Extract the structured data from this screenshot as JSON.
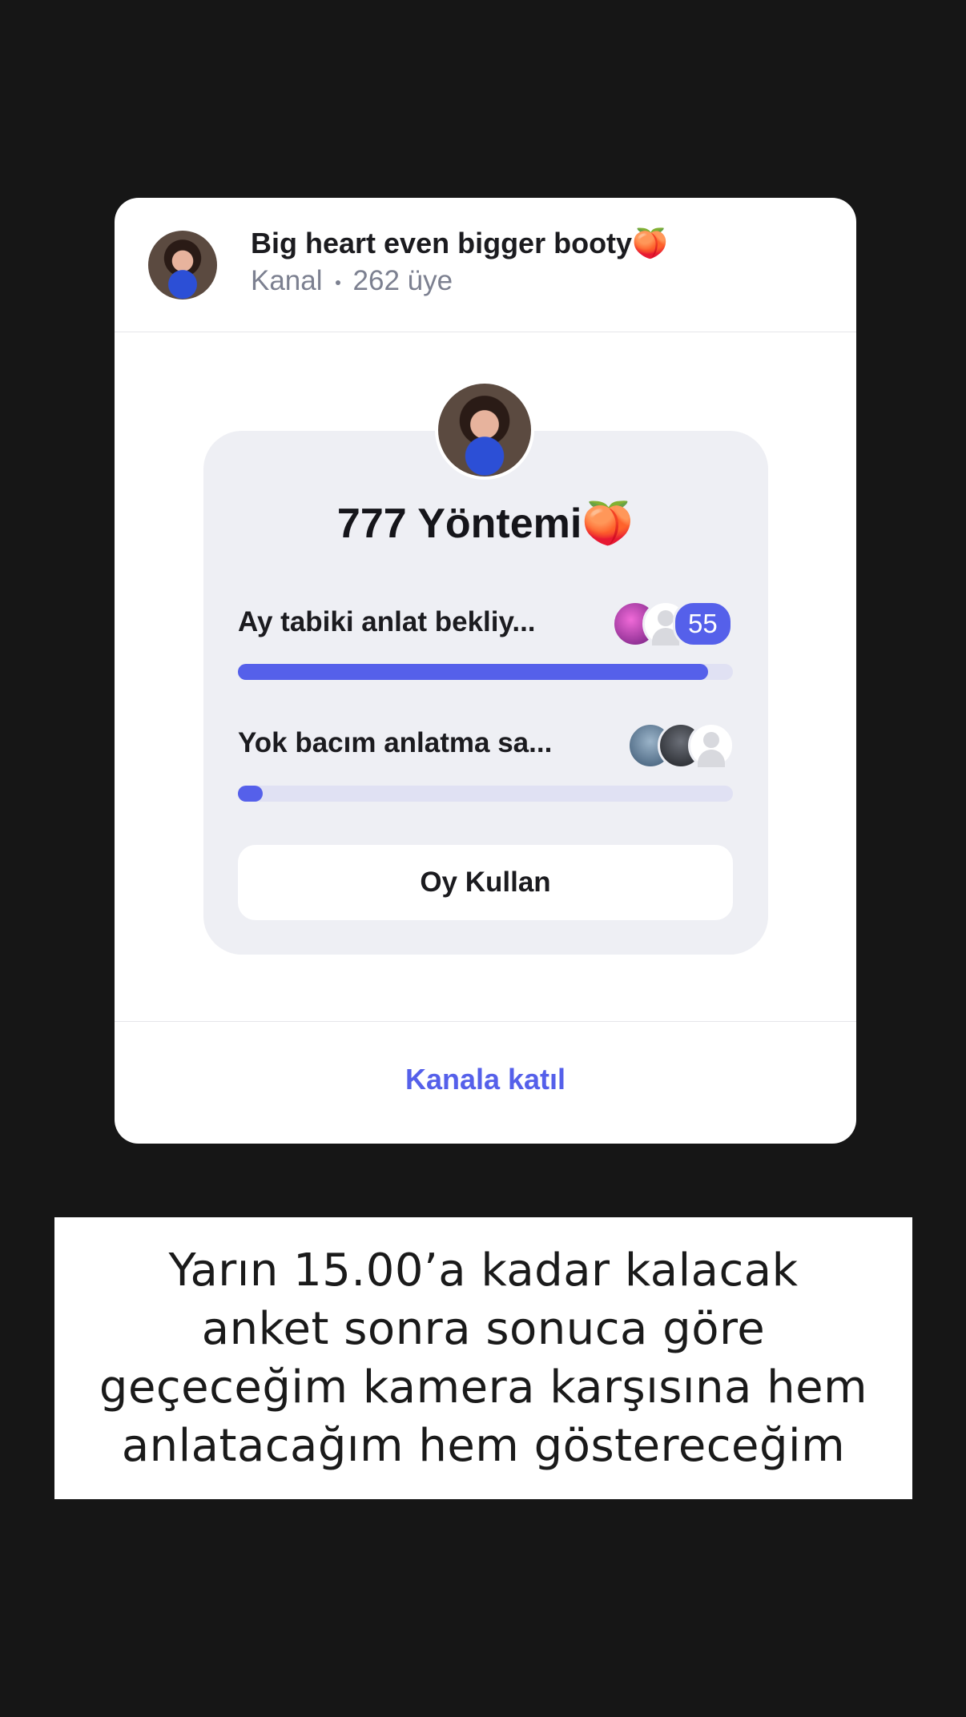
{
  "channel": {
    "name": "Big heart even bigger booty🍑",
    "type": "Kanal",
    "members": "262 üye"
  },
  "poll": {
    "title": "777 Yöntemi🍑",
    "options": [
      {
        "label": "Ay tabiki anlat bekliy...",
        "vote_count_badge": "55",
        "fraction": 0.95
      },
      {
        "label": "Yok bacım anlatma sa...",
        "fraction": 0.05
      }
    ],
    "vote_button": "Oy Kullan"
  },
  "join_label": "Kanala katıl",
  "caption": "Yarın 15.00’a kadar kalacak\nanket sonra sonuca göre\ngeçeceğim kamera karşısına hem\nanlatacağım hem göstereceğim",
  "colors": {
    "background": "#161616",
    "accent": "#5560ea",
    "poll_background": "#eeeff4"
  }
}
